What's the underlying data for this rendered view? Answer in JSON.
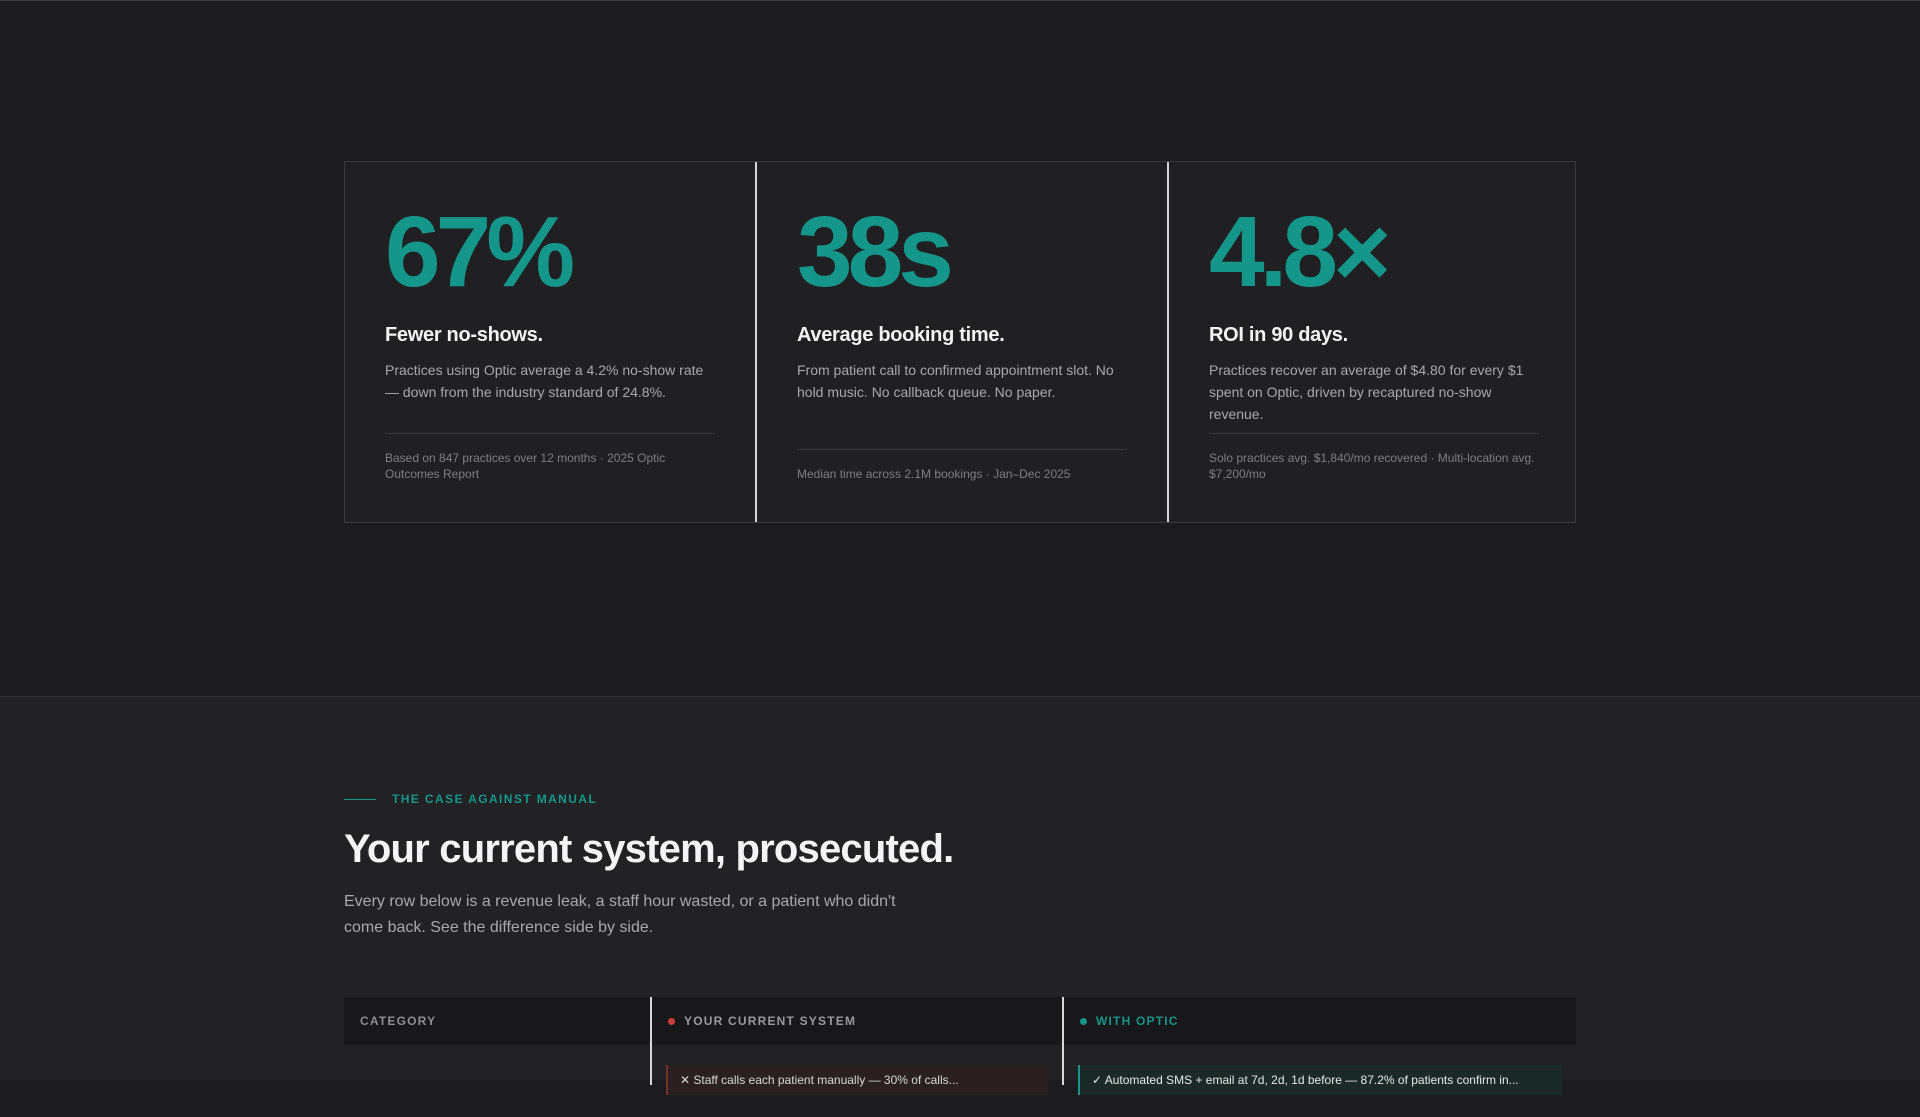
{
  "stats": [
    {
      "number": "67%",
      "title": "Fewer no-shows.",
      "description": "Practices using Optic average a 4.2% no-show rate — down from the industry standard of 24.8%.",
      "footnote": "Based on 847 practices over 12 months · 2025 Optic Outcomes Report"
    },
    {
      "number": "38s",
      "title": "Average booking time.",
      "description": "From patient call to confirmed appointment slot. No hold music. No callback queue. No paper.",
      "footnote": "Median time across 2.1M bookings · Jan–Dec 2025"
    },
    {
      "number": "4.8×",
      "title": "ROI in 90 days.",
      "description": "Practices recover an average of $4.80 for every $1 spent on Optic, driven by recaptured no-show revenue.",
      "footnote": "Solo practices avg. $1,840/mo recovered · Multi-location avg. $7,200/mo"
    }
  ],
  "compare": {
    "eyebrow": "THE CASE AGAINST MANUAL",
    "title": "Your current system, prosecuted.",
    "lead": "Every row below is a revenue leak, a staff hour wasted, or a patient who didn't come back. See the difference side by side.",
    "columns": {
      "category": "CATEGORY",
      "current": "YOUR CURRENT SYSTEM",
      "optic": "WITH OPTIC"
    },
    "first_row": {
      "current": "✕  Staff calls each patient manually — 30% of calls...",
      "optic": "✓  Automated SMS + email at 7d, 2d, 1d before — 87.2% of patients confirm in..."
    }
  },
  "colors": {
    "accent": "#14968a",
    "negative": "#c9403d",
    "background": "#1c1c1e"
  }
}
